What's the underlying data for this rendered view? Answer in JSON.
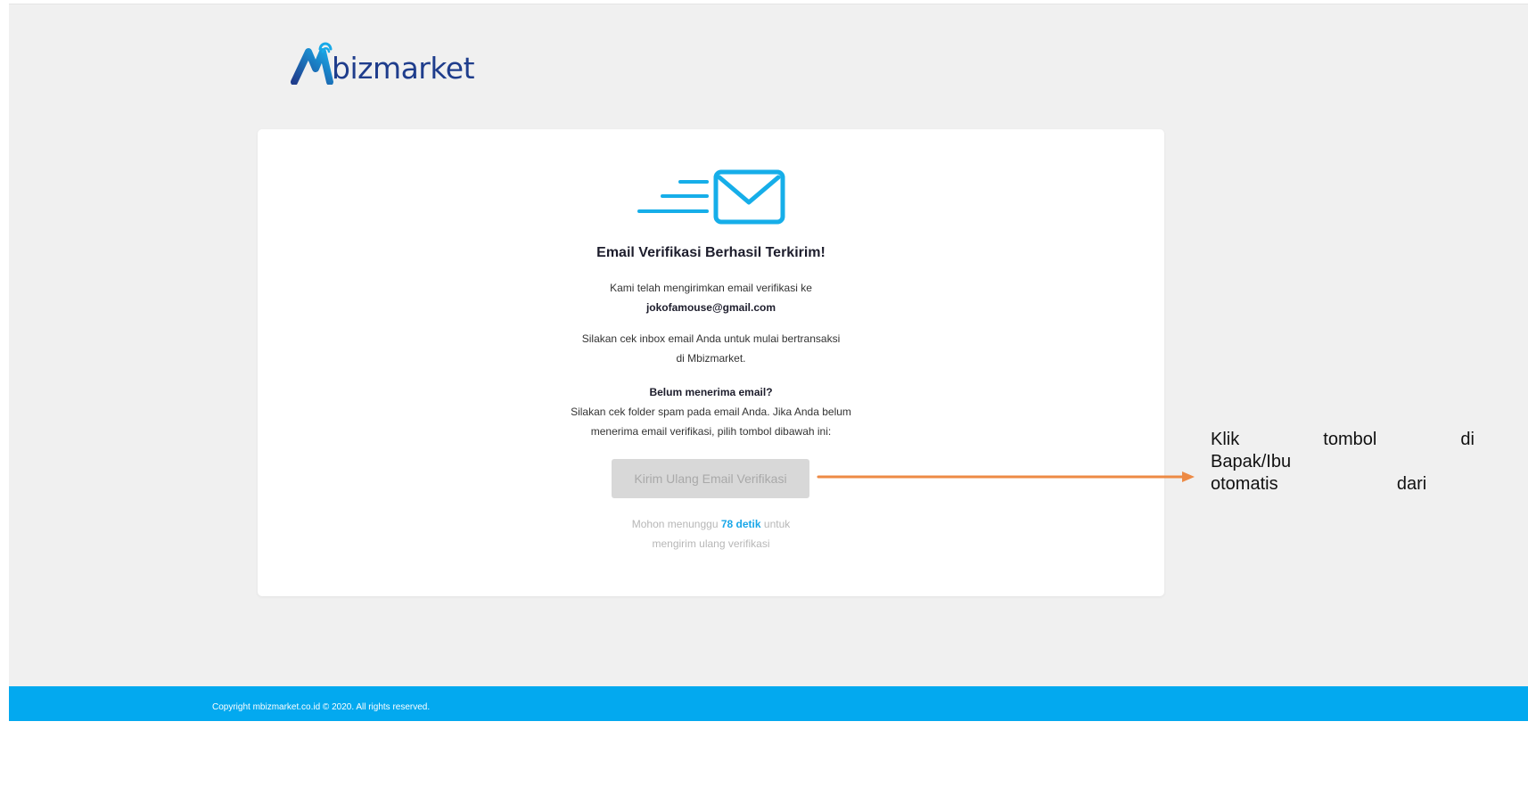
{
  "logo": {
    "text": "bizmarket"
  },
  "card": {
    "icon": "email-sent-icon",
    "title": "Email Verifikasi Berhasil Terkirim!",
    "sent_text": "Kami telah mengirimkan email verifikasi ke",
    "email": "jokofamouse@gmail.com",
    "inbox_line1": "Silakan cek inbox email Anda untuk mulai bertransaksi",
    "inbox_line2": "di Mbizmarket.",
    "not_received_heading": "Belum menerima email?",
    "spam_line1": "Silakan cek folder spam pada email Anda. Jika Anda belum",
    "spam_line2": "menerima email verifikasi, pilih tombol dibawah ini:",
    "resend_button": "Kirim Ulang Email Verifikasi",
    "wait_prefix": "Mohon menunggu",
    "wait_countdown": "78 detik",
    "wait_suffix": "untuk",
    "wait_line2": "mengirim ulang verifikasi"
  },
  "footer": {
    "copyright": "Copyright mbizmarket.co.id © 2020. All rights reserved."
  },
  "annotation": {
    "line1": "Klik tombol di s",
    "line2": "Bapak/Ibu dafta",
    "line3": "otomatis dari sis"
  },
  "colors": {
    "brand_blue": "#03a9ef",
    "logo_navy": "#1f3d8c",
    "arrow_orange": "#ed8a45",
    "background": "#f0f0f0"
  }
}
